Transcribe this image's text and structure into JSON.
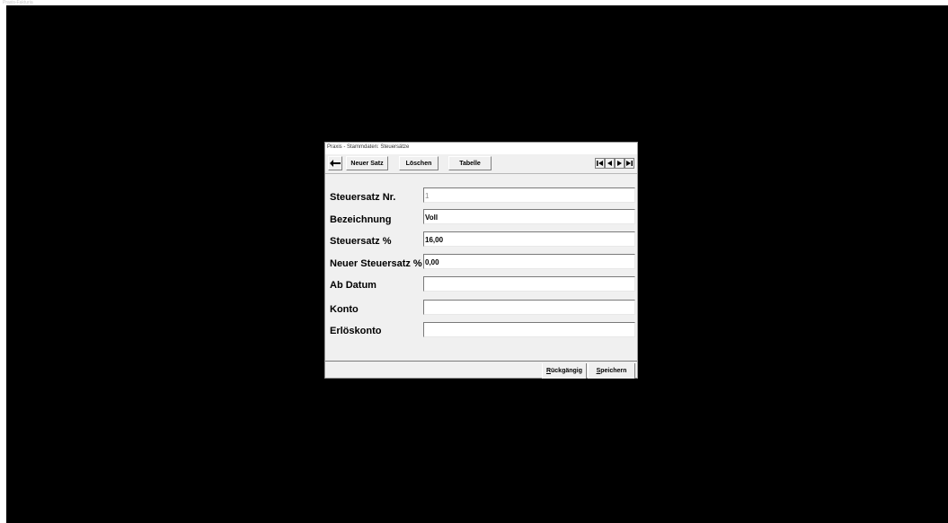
{
  "screen": {
    "caption": "Praxis-Fakturia"
  },
  "dialog": {
    "title": "Praxis - Stammdaten: Steuersätze",
    "toolbar": {
      "back_icon": "arrow-left-icon",
      "new_label": "Neuer Satz",
      "delete_label": "Löschen",
      "table_label": "Tabelle",
      "nav": {
        "first_icon": "first-record-icon",
        "prev_icon": "prev-record-icon",
        "next_icon": "next-record-icon",
        "last_icon": "last-record-icon"
      }
    },
    "fields": {
      "nr": {
        "label": "Steuersatz Nr.",
        "value": "1"
      },
      "bezeichnung": {
        "label": "Bezeichnung",
        "value": "Voll"
      },
      "steuersatz": {
        "label": "Steuersatz %",
        "value": "16,00"
      },
      "neuer": {
        "label": "Neuer Steuersatz %",
        "value": "0,00"
      },
      "ab_datum": {
        "label": "Ab Datum",
        "value": ""
      },
      "konto": {
        "label": "Konto",
        "value": ""
      },
      "erloeskonto": {
        "label": "Erlöskonto",
        "value": ""
      }
    },
    "footer": {
      "undo_first": "R",
      "undo_rest": "ückgängig",
      "save_first": "S",
      "save_rest": "peichern"
    }
  }
}
